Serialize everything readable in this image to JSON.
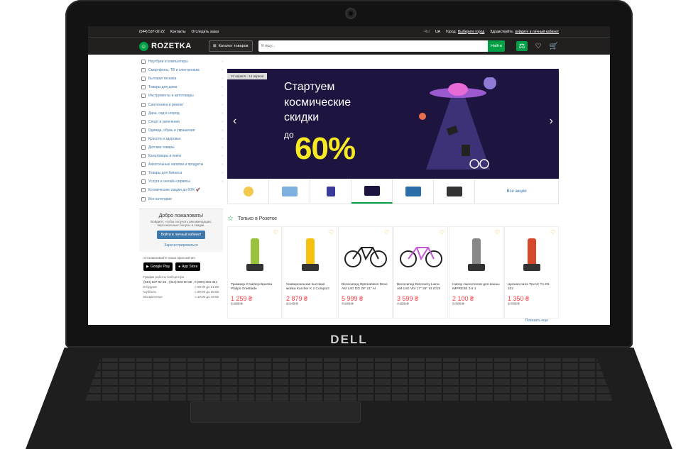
{
  "device": {
    "logo": "DELL"
  },
  "topbar": {
    "phone": "(044) 537-02-22",
    "links": [
      "Контакты",
      "Отследить заказ"
    ],
    "lang_active": "RU",
    "lang_other": "UA",
    "city_label": "Город:",
    "city_value": "Выберите город",
    "greeting": "Здравствуйте,",
    "login": "войдите в личный кабинет"
  },
  "header": {
    "brand": "ROZETKA",
    "catalog_button": "Каталог товаров",
    "search_placeholder": "Я ищу...",
    "search_button": "Найти"
  },
  "sidebar": {
    "items": [
      {
        "label": "Ноутбуки и компьютеры",
        "arrow": true
      },
      {
        "label": "Смартфоны, ТВ и электроника",
        "arrow": true
      },
      {
        "label": "Бытовая техника",
        "arrow": true
      },
      {
        "label": "Товары для дома",
        "arrow": true
      },
      {
        "label": "Инструменты и автотовары",
        "arrow": true
      },
      {
        "label": "Сантехника и ремонт",
        "arrow": true
      },
      {
        "label": "Дача, сад и огород",
        "arrow": true
      },
      {
        "label": "Спорт и увлечения",
        "arrow": true
      },
      {
        "label": "Одежда, обувь и украшения",
        "arrow": true
      },
      {
        "label": "Красота и здоровье",
        "arrow": true
      },
      {
        "label": "Детские товары",
        "arrow": true
      },
      {
        "label": "Канцтовары и книги",
        "arrow": true
      },
      {
        "label": "Алкогольные напитки и продукты",
        "arrow": true
      },
      {
        "label": "Товары для бизнеса",
        "arrow": true
      },
      {
        "label": "Услуги и онлайн-сервисы",
        "arrow": true
      },
      {
        "label": "Космические скидки до 60% 🚀",
        "arrow": false
      },
      {
        "label": "Все категории",
        "arrow": false
      }
    ]
  },
  "welcome": {
    "title": "Добро пожаловать!",
    "text": "Войдите, чтобы получать рекомендации, персональные бонусы и скидки.",
    "login_button": "Войти в личный кабинет",
    "register": "Зарегистрироваться"
  },
  "apps": {
    "label": "Устанавливайте наши приложения",
    "google": "Google Play",
    "apple": "App Store"
  },
  "callcenter": {
    "title": "График работы Call-центра",
    "phones": "(044) 537-02-22 , (044) 503-80-80 , 0 (800) 303-344",
    "schedule": [
      {
        "day": "В будние",
        "time": "с 08:00 до 21:00"
      },
      {
        "day": "Суббота",
        "time": "с 09:00 до 20:00"
      },
      {
        "day": "Воскресенье",
        "time": "с 10:00 до 19:00"
      }
    ]
  },
  "banner": {
    "dates": "10 апреля - 14 апреля",
    "line1": "Стартуем",
    "line2": "космические",
    "line3": "скидки",
    "upto": "до",
    "percent": "60%"
  },
  "promo_tabs": {
    "all_sales": "Все акции"
  },
  "section": {
    "title": "Только в Розетке",
    "more": "Показать еще"
  },
  "products": [
    {
      "name": "Триммер-Стайлер-Бритва Philips OneBlade",
      "price": "1 259 ₴",
      "old": "1 399 ₴"
    },
    {
      "name": "Универсальная бытовая мойка Karcher K 2 Compact",
      "price": "2 879 ₴",
      "old": "3 149 ₴"
    },
    {
      "name": "Велосипед Optimabikes Drive AM 14G DD 29\" 21\" Al",
      "price": "5 999 ₴",
      "old": "7 246 ₴"
    },
    {
      "name": "Велосипед Discovery Liana AM 14G Vbr 17\" 26\" St 2019",
      "price": "3 599 ₴",
      "old": "4 320 ₴"
    },
    {
      "name": "Набор смесителей для ванны IMPRESE 3 в 1",
      "price": "2 100 ₴",
      "old": "2 706 ₴"
    },
    {
      "name": "Цепная пила TexAC TA-03-222",
      "price": "1 350 ₴",
      "old": "1 700 ₴"
    }
  ]
}
